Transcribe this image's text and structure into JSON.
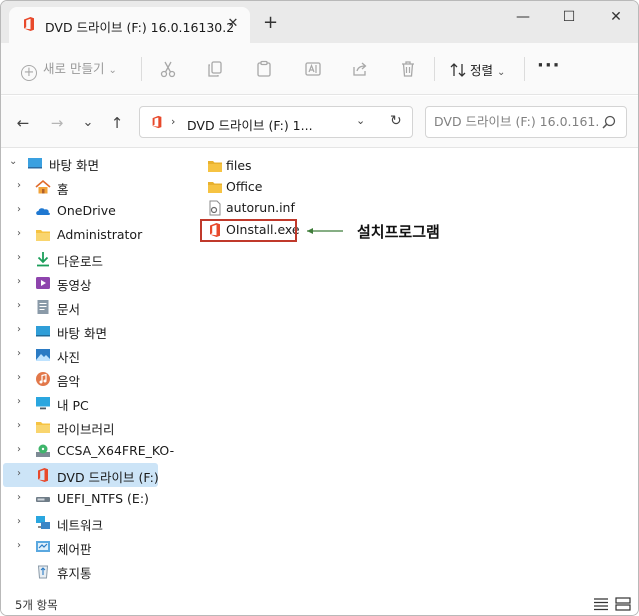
{
  "window": {
    "tab_title": "DVD 드라이브 (F:) 16.0.16130.2",
    "tab_close": "✕",
    "new_tab": "+",
    "minimize": "—",
    "maximize": "☐",
    "close": "✕"
  },
  "toolbar": {
    "new_label": "새로 만들기",
    "sort_label": "정렬",
    "more": "···",
    "icons": [
      "cut-icon",
      "copy-icon",
      "paste-icon",
      "rename-icon",
      "share-icon",
      "delete-icon"
    ]
  },
  "nav": {
    "back": "←",
    "forward": "→",
    "recent": "⌄",
    "up": "↑"
  },
  "address": {
    "text": "DVD 드라이브 (F:) 1..."
  },
  "search": {
    "placeholder": "DVD 드라이브 (F:) 16.0.161..."
  },
  "sidebar": {
    "items": [
      {
        "label": "바탕 화면",
        "icon": "desktop-icon",
        "expanded": true
      },
      {
        "label": "홈",
        "icon": "home-icon"
      },
      {
        "label": "OneDrive",
        "icon": "onedrive-icon"
      },
      {
        "label": "Administrator",
        "icon": "folder-icon"
      },
      {
        "label": "다운로드",
        "icon": "download-icon"
      },
      {
        "label": "동영상",
        "icon": "video-icon"
      },
      {
        "label": "문서",
        "icon": "document-icon"
      },
      {
        "label": "바탕 화면",
        "icon": "desktop-icon"
      },
      {
        "label": "사진",
        "icon": "picture-icon"
      },
      {
        "label": "음악",
        "icon": "music-icon"
      },
      {
        "label": "내 PC",
        "icon": "pc-icon"
      },
      {
        "label": "라이브러리",
        "icon": "library-icon"
      },
      {
        "label": "CCSA_X64FRE_KO-",
        "icon": "disc-drive-icon"
      },
      {
        "label": "DVD 드라이브 (F:)",
        "icon": "office-icon",
        "selected": true
      },
      {
        "label": "UEFI_NTFS (E:)",
        "icon": "drive-icon"
      },
      {
        "label": "네트워크",
        "icon": "network-icon"
      },
      {
        "label": "제어판",
        "icon": "control-panel-icon"
      },
      {
        "label": "휴지통",
        "icon": "recycle-bin-icon"
      }
    ]
  },
  "files": [
    {
      "name": "files",
      "icon": "folder-icon"
    },
    {
      "name": "Office",
      "icon": "folder-icon"
    },
    {
      "name": "autorun.inf",
      "icon": "settings-file-icon"
    },
    {
      "name": "OInstall.exe",
      "icon": "office-icon"
    }
  ],
  "annotation": {
    "label": "설치프로그램",
    "color": "#c0392b"
  },
  "status": {
    "count": "5개 항목"
  },
  "colors": {
    "selection": "#cce4f7",
    "office_red": "#e8492b",
    "folder_yellow": "#f6c342"
  }
}
